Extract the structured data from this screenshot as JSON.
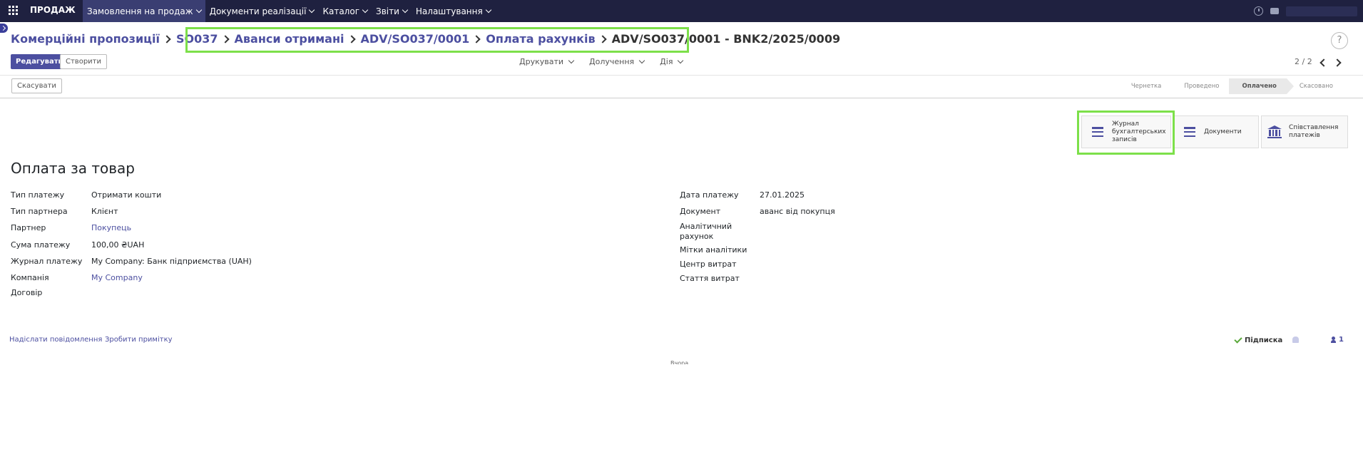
{
  "topbar": {
    "app_name": "ПРОДАЖ",
    "menu": [
      {
        "label": "Замовлення на продаж",
        "active": true
      },
      {
        "label": "Документи реалізації"
      },
      {
        "label": "Каталог"
      },
      {
        "label": "Звіти"
      },
      {
        "label": "Налаштування"
      }
    ]
  },
  "breadcrumb": [
    "Комерційні пропозиції",
    "SO037",
    "Аванси отримані",
    "ADV/SO037/0001",
    "Оплата рахунків",
    "ADV/SO037/0001 - BNK2/2025/0009"
  ],
  "help_label": "?",
  "buttons": {
    "edit": "Редагувати",
    "create": "Створити",
    "cancel": "Скасувати"
  },
  "actions": {
    "print": "Друкувати",
    "attach": "Долучення",
    "action": "Дія"
  },
  "pager": "2 / 2",
  "status_stages": [
    {
      "label": "Чернетка"
    },
    {
      "label": "Проведено"
    },
    {
      "label": "Оплачено",
      "active": true
    },
    {
      "label": "Скасовано"
    }
  ],
  "smart_buttons": {
    "journal": "Журнал бухгалтерських записів",
    "documents": "Документи",
    "reconciliation": "Співставлення платежів"
  },
  "form": {
    "title": "Оплата за товар",
    "left": {
      "payment_type": {
        "label": "Тип платежу",
        "value": "Отримати кошти"
      },
      "partner_type": {
        "label": "Тип партнера",
        "value": "Клієнт"
      },
      "partner": {
        "label": "Партнер",
        "value": "Покупець"
      },
      "amount": {
        "label": "Сума платежу",
        "value": "100,00 ₴UAH"
      },
      "journal": {
        "label": "Журнал платежу",
        "value": "My Company: Банк підприємства (UAH)"
      },
      "company": {
        "label": "Компанія",
        "value": "My Company"
      },
      "contract": {
        "label": "Договір",
        "value": ""
      }
    },
    "right": {
      "date": {
        "label": "Дата платежу",
        "value": "27.01.2025"
      },
      "document": {
        "label": "Документ",
        "value": "аванс від покупця"
      },
      "analytic_account": {
        "label": "Аналітичний рахунок",
        "value": ""
      },
      "analytic_tags": {
        "label": "Мітки аналітики",
        "value": ""
      },
      "cost_center": {
        "label": "Центр витрат",
        "value": ""
      },
      "expense_item": {
        "label": "Стаття витрат",
        "value": ""
      }
    }
  },
  "chatter": {
    "send_message": "Надіслати повідомлення",
    "log_note": "Зробити примітку",
    "follow": "Підписка",
    "followers": "1",
    "today": "Вчора"
  },
  "colors": {
    "topbar": "#1f2140",
    "accent": "#4c4fa0",
    "highlight": "#7de04a"
  }
}
